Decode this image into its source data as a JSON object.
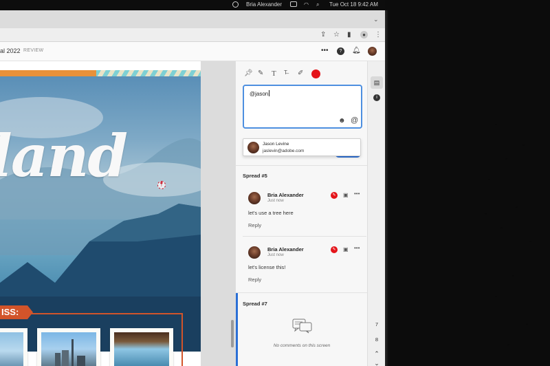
{
  "menubar": {
    "user": "Bria Alexander",
    "datetime": "Tue Oct 18  9:42 AM"
  },
  "document": {
    "title": "al 2022",
    "status": "REVIEW"
  },
  "artwork": {
    "headline": "land",
    "banner": "ISS:"
  },
  "composer": {
    "value": "@jason",
    "mention_suggestion": {
      "name": "Jason Levine",
      "email": "jaslevin@adobe.com"
    },
    "annotation_color": "#e4141a"
  },
  "spreads": [
    {
      "label": "Spread #5",
      "comments": [
        {
          "author": "Bria Alexander",
          "time": "Just now",
          "text": "let's use a tree here",
          "reply_label": "Reply"
        },
        {
          "author": "Bria Alexander",
          "time": "Just now",
          "text": "let's license this!",
          "reply_label": "Reply"
        }
      ]
    },
    {
      "label": "Spread #7",
      "empty_text": "No comments on this screen"
    }
  ],
  "rail": {
    "current_page": "7",
    "total_pages": "8"
  },
  "colors": {
    "accent": "#2a6fd6",
    "annotation_red": "#e4141a",
    "brand_orange": "#d2542a"
  }
}
